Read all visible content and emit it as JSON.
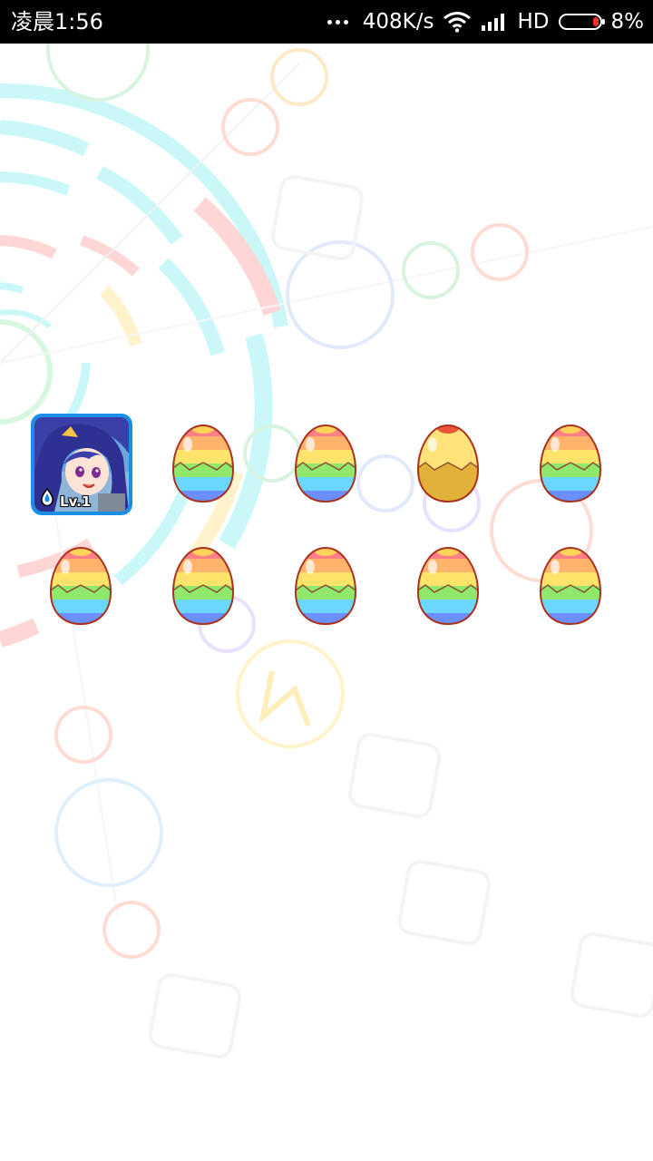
{
  "status_bar": {
    "time": "凌晨1:56",
    "network_speed": "408K/s",
    "network_type": "HD",
    "battery_percent": "8%",
    "icons": [
      "more-dots-icon",
      "wifi-icon",
      "cellular-signal-icon",
      "battery-icon"
    ]
  },
  "character": {
    "level_label": "Lv.1",
    "icon": "water-drop-icon"
  },
  "eggs": [
    {
      "type": "rainbow"
    },
    {
      "type": "rainbow"
    },
    {
      "type": "golden"
    },
    {
      "type": "rainbow"
    },
    {
      "type": "rainbow"
    },
    {
      "type": "rainbow"
    },
    {
      "type": "rainbow"
    },
    {
      "type": "rainbow"
    },
    {
      "type": "rainbow"
    }
  ],
  "colors": {
    "avatar_frame": "#1a8fe8",
    "battery_low": "#ff2a2a",
    "status_bar_bg": "#000000"
  }
}
